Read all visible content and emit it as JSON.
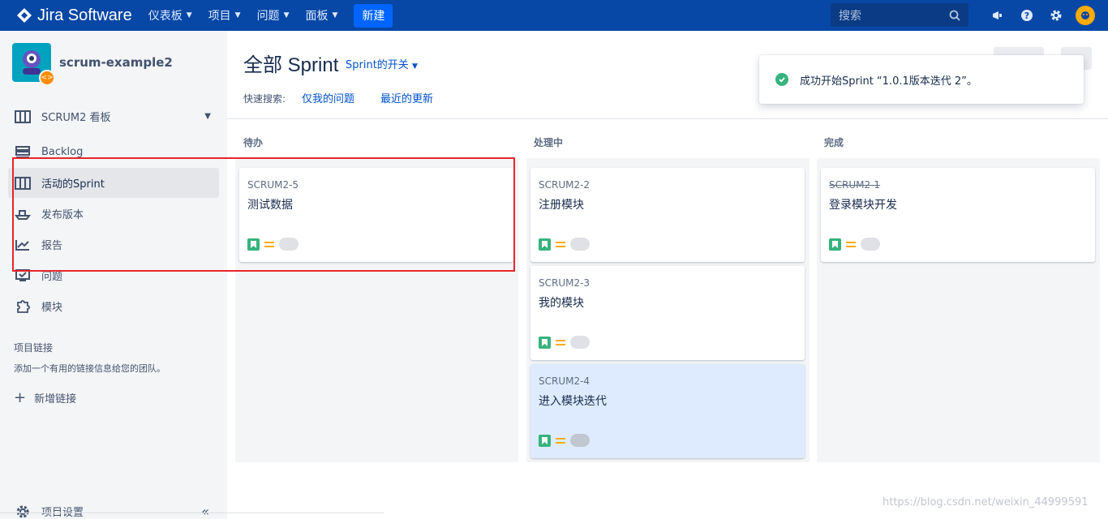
{
  "topnav": {
    "brand": "Jira Software",
    "items": [
      {
        "label": "仪表板"
      },
      {
        "label": "项目"
      },
      {
        "label": "问题"
      },
      {
        "label": "面板"
      }
    ],
    "create_label": "新建",
    "search_placeholder": "搜索"
  },
  "sidebar": {
    "project_name": "scrum-example2",
    "board_label": "SCRUM2 看板",
    "items": [
      {
        "label": "Backlog"
      },
      {
        "label": "活动的Sprint"
      },
      {
        "label": "发布版本"
      },
      {
        "label": "报告"
      },
      {
        "label": "问题"
      },
      {
        "label": "模块"
      }
    ],
    "links_title": "项目链接",
    "links_desc": "添加一个有用的链接信息给您的团队。",
    "add_link": "新增链接",
    "settings": "项目设置"
  },
  "header": {
    "title": "全部 Sprint",
    "sprint_toggle": "Sprint的开关",
    "quick_search_label": "快速搜索:",
    "quick_links": [
      "仅我的问题",
      "最近的更新"
    ]
  },
  "columns": [
    {
      "title": "待办",
      "cards": [
        {
          "key": "SCRUM2-5",
          "summary": "测试数据",
          "done": false,
          "selected": false
        }
      ]
    },
    {
      "title": "处理中",
      "cards": [
        {
          "key": "SCRUM2-2",
          "summary": "注册模块",
          "done": false,
          "selected": false
        },
        {
          "key": "SCRUM2-3",
          "summary": "我的模块",
          "done": false,
          "selected": false
        },
        {
          "key": "SCRUM2-4",
          "summary": "进入模块迭代",
          "done": false,
          "selected": true
        }
      ]
    },
    {
      "title": "完成",
      "cards": [
        {
          "key": "SCRUM2-1",
          "summary": "登录模块开发",
          "done": true,
          "selected": false
        }
      ]
    }
  ],
  "toast": {
    "message": "成功开始Sprint “1.0.1版本迭代 2”。"
  },
  "watermark": "https://blog.csdn.net/weixin_44999591",
  "colors": {
    "nav_bg": "#0747a6",
    "accent": "#0052cc",
    "annotation": "#e8262a",
    "story": "#36b37e",
    "priority": "#ffab00"
  }
}
